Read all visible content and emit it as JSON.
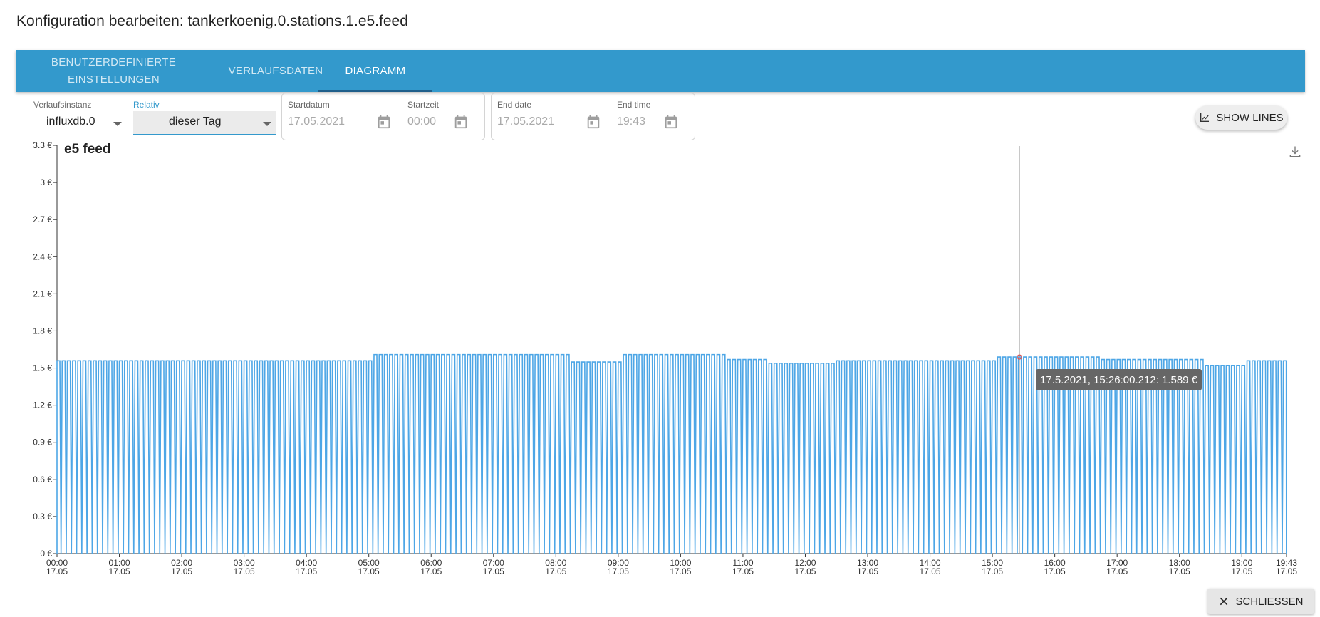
{
  "dialog": {
    "title": "Konfiguration bearbeiten: tankerkoenig.0.stations.1.e5.feed"
  },
  "tabs": [
    {
      "label_line1": "Benutzerdefinierte",
      "label_line2": "Einstellungen"
    },
    {
      "label": "Verlaufsdaten"
    },
    {
      "label": "Diagramm",
      "active": true
    }
  ],
  "filters": {
    "instance": {
      "label": "Verlaufsinstanz",
      "value": "influxdb.0"
    },
    "relative": {
      "label": "Relativ",
      "value": "dieser Tag"
    },
    "start_date": {
      "label": "Startdatum",
      "value": "17.05.2021"
    },
    "start_time": {
      "label": "Startzeit",
      "value": "00:00"
    },
    "end_date": {
      "label": "End date",
      "value": "17.05.2021"
    },
    "end_time": {
      "label": "End time",
      "value": "19:43"
    }
  },
  "buttons": {
    "show_lines": "Show lines",
    "close": "Schliessen"
  },
  "icons": {
    "calendar": "calendar-icon",
    "chart": "chart-line-icon",
    "download": "download-icon",
    "close": "close-icon"
  },
  "colors": {
    "tabbar": "#3399cc",
    "series": "#4da6e6",
    "tooltip": "#666666"
  },
  "tooltip": {
    "text": "17.5.2021, 15:26:00.212: 1.589 €"
  },
  "chart_data": {
    "type": "line",
    "title": "e5 feed",
    "ylim": [
      0,
      3.3
    ],
    "y_ticks": [
      "0 €",
      "0.3 €",
      "0.6 €",
      "0.9 €",
      "1.2 €",
      "1.5 €",
      "1.8 €",
      "2.1 €",
      "2.4 €",
      "2.7 €",
      "3 €",
      "3.3 €"
    ],
    "x_range": [
      "00:00 17.05",
      "19:43 17.05"
    ],
    "x_ticks": [
      {
        "time": "00:00",
        "date": "17.05"
      },
      {
        "time": "01:00",
        "date": "17.05"
      },
      {
        "time": "02:00",
        "date": "17.05"
      },
      {
        "time": "03:00",
        "date": "17.05"
      },
      {
        "time": "04:00",
        "date": "17.05"
      },
      {
        "time": "05:00",
        "date": "17.05"
      },
      {
        "time": "06:00",
        "date": "17.05"
      },
      {
        "time": "07:00",
        "date": "17.05"
      },
      {
        "time": "08:00",
        "date": "17.05"
      },
      {
        "time": "09:00",
        "date": "17.05"
      },
      {
        "time": "10:00",
        "date": "17.05"
      },
      {
        "time": "11:00",
        "date": "17.05"
      },
      {
        "time": "12:00",
        "date": "17.05"
      },
      {
        "time": "13:00",
        "date": "17.05"
      },
      {
        "time": "14:00",
        "date": "17.05"
      },
      {
        "time": "15:00",
        "date": "17.05"
      },
      {
        "time": "16:00",
        "date": "17.05"
      },
      {
        "time": "17:00",
        "date": "17.05"
      },
      {
        "time": "18:00",
        "date": "17.05"
      },
      {
        "time": "19:00",
        "date": "17.05"
      },
      {
        "time": "19:43",
        "date": "17.05"
      }
    ],
    "series": [
      {
        "description": "price pulses alternating between about 1.55–1.61 € and 0 €, roughly every 5 minutes",
        "levels": [
          {
            "from": "00:00",
            "to": "05:00",
            "value": 1.559
          },
          {
            "from": "05:05",
            "to": "08:10",
            "value": 1.609
          },
          {
            "from": "08:15",
            "to": "09:00",
            "value": 1.549
          },
          {
            "from": "09:05",
            "to": "10:40",
            "value": 1.609
          },
          {
            "from": "10:45",
            "to": "11:20",
            "value": 1.569
          },
          {
            "from": "11:25",
            "to": "12:25",
            "value": 1.539
          },
          {
            "from": "12:30",
            "to": "15:00",
            "value": 1.559
          },
          {
            "from": "15:05",
            "to": "16:40",
            "value": 1.589
          },
          {
            "from": "16:45",
            "to": "18:20",
            "value": 1.569
          },
          {
            "from": "18:25",
            "to": "19:00",
            "value": 1.519
          },
          {
            "from": "19:05",
            "to": "19:43",
            "value": 1.559
          }
        ]
      }
    ],
    "cursor": {
      "time": "15:26",
      "value": 1.589
    },
    "grid": false
  }
}
